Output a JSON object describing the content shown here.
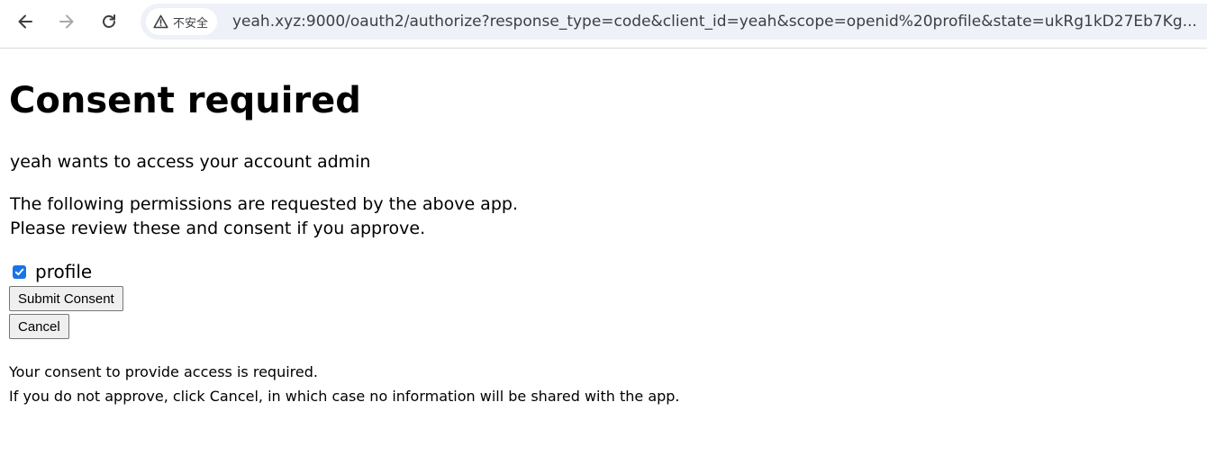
{
  "browser": {
    "security_label": "不安全",
    "url": "yeah.xyz:9000/oauth2/authorize?response_type=code&client_id=yeah&scope=openid%20profile&state=ukRg1kD27Eb7Kg..."
  },
  "page": {
    "title": "Consent required",
    "request_line": "yeah wants to access your account admin",
    "permissions_line1": "The following permissions are requested by the above app.",
    "permissions_line2": "Please review these and consent if you approve.",
    "scopes": [
      {
        "label": "profile",
        "checked": true
      }
    ],
    "submit_label": "Submit Consent",
    "cancel_label": "Cancel",
    "note_line1": "Your consent to provide access is required.",
    "note_line2": "If you do not approve, click Cancel, in which case no information will be shared with the app."
  },
  "colors": {
    "accent": "#1a73e8",
    "omnibox_bg": "#eef1f8"
  }
}
